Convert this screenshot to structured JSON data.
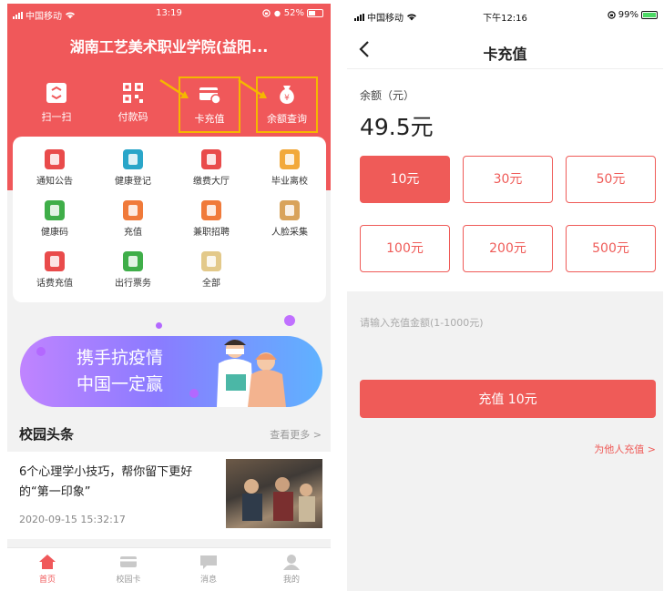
{
  "left": {
    "status": {
      "carrier": "中国移动",
      "time": "13:19",
      "battery": "52%",
      "battery_level": 0.52
    },
    "title": "湖南工艺美术职业学院(益阳...",
    "quick": [
      {
        "label": "扫一扫",
        "icon": "scan-icon"
      },
      {
        "label": "付款码",
        "icon": "qrcode-icon"
      },
      {
        "label": "卡充值",
        "icon": "card-recharge-icon"
      },
      {
        "label": "余额查询",
        "icon": "money-bag-icon"
      }
    ],
    "grid": [
      {
        "label": "通知公告",
        "icon": "notice-icon",
        "color": "#e94b4b"
      },
      {
        "label": "健康登记",
        "icon": "health-register-icon",
        "color": "#2aa6c9"
      },
      {
        "label": "缴费大厅",
        "icon": "payment-icon",
        "color": "#e94b4b"
      },
      {
        "label": "毕业离校",
        "icon": "graduation-icon",
        "color": "#f2a93b"
      },
      {
        "label": "健康码",
        "icon": "health-code-icon",
        "color": "#3fae49"
      },
      {
        "label": "充值",
        "icon": "recharge-icon",
        "color": "#f07a3a"
      },
      {
        "label": "兼职招聘",
        "icon": "job-icon",
        "color": "#f07a3a"
      },
      {
        "label": "人脸采集",
        "icon": "face-capture-icon",
        "color": "#d9a35a"
      },
      {
        "label": "话费充值",
        "icon": "phone-bill-icon",
        "color": "#e94b4b"
      },
      {
        "label": "出行票务",
        "icon": "ticket-icon",
        "color": "#3fae49"
      },
      {
        "label": "全部",
        "icon": "all-icon",
        "color": "#e3c98a"
      }
    ],
    "banner": {
      "line1": "携手抗疫情",
      "line2": "中国一定赢"
    },
    "news": {
      "heading": "校园头条",
      "more": "查看更多 >",
      "item": {
        "title": "6个心理学小技巧，帮你留下更好的“第一印象”",
        "date": "2020-09-15 15:32:17"
      }
    },
    "tabs": [
      {
        "label": "首页",
        "icon": "home-icon"
      },
      {
        "label": "校园卡",
        "icon": "campus-card-icon"
      },
      {
        "label": "消息",
        "icon": "message-icon"
      },
      {
        "label": "我的",
        "icon": "profile-icon"
      }
    ],
    "colors": {
      "header": "#f0585a",
      "highlight": "#f5b700"
    }
  },
  "right": {
    "status": {
      "carrier": "中国移动",
      "time": "下午12:16",
      "battery": "99%",
      "battery_level": 0.99
    },
    "title": "卡充值",
    "balance_label": "余额（元）",
    "balance_value": "49.5元",
    "amounts": [
      "10元",
      "30元",
      "50元",
      "100元",
      "200元",
      "500元"
    ],
    "selected_amount": "10元",
    "input_placeholder": "请输入充值金额(1-1000元)",
    "submit_label": "充值 10元",
    "other_link": "为他人充值 >",
    "colors": {
      "accent": "#ef5b58"
    }
  }
}
